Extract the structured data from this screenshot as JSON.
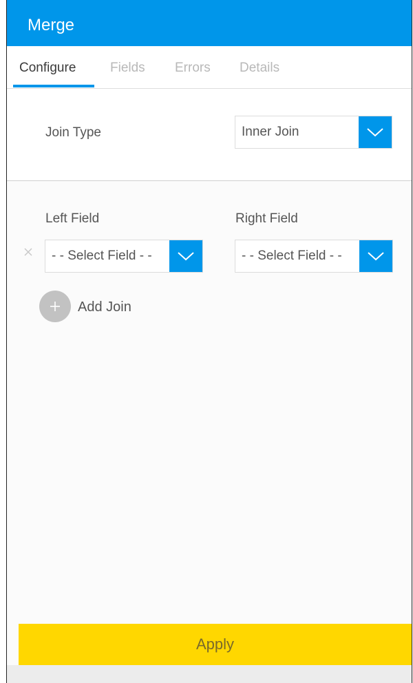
{
  "header": {
    "title": "Merge"
  },
  "tabs": [
    {
      "label": "Configure",
      "active": true
    },
    {
      "label": "Fields",
      "active": false
    },
    {
      "label": "Errors",
      "active": false
    },
    {
      "label": "Details",
      "active": false
    }
  ],
  "join_type": {
    "label": "Join Type",
    "value": "Inner Join"
  },
  "fields": {
    "left_label": "Left Field",
    "right_label": "Right Field",
    "left_value": "- - Select Field - -",
    "right_value": "- - Select Field - -"
  },
  "add_join": {
    "label": "Add Join"
  },
  "apply": {
    "label": "Apply"
  },
  "colors": {
    "accent": "#0096ea",
    "apply": "#ffd700"
  },
  "icons": {
    "dropdown": "chevron-down-icon",
    "remove": "close-icon",
    "add": "plus-icon"
  }
}
